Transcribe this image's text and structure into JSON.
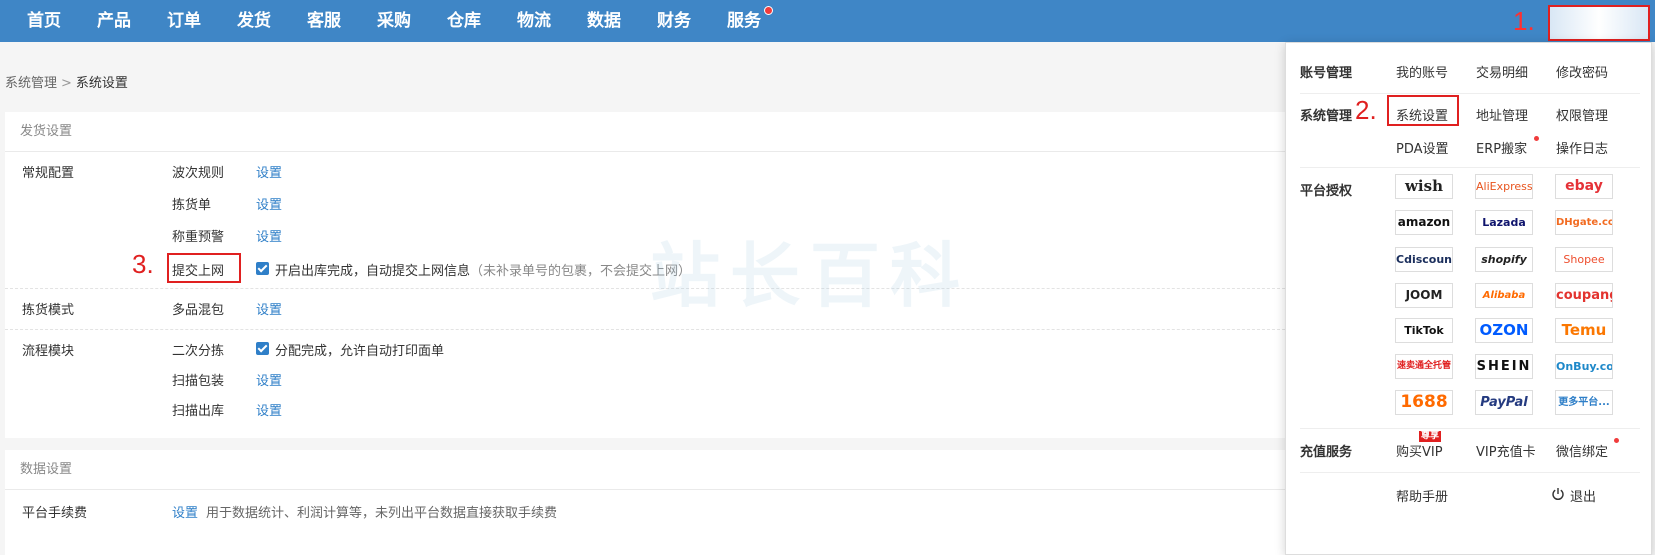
{
  "nav": {
    "items": [
      "首页",
      "产品",
      "订单",
      "发货",
      "客服",
      "采购",
      "仓库",
      "物流",
      "数据",
      "财务",
      "服务"
    ],
    "accent": "#3f86c6"
  },
  "markers": {
    "m1": "1.",
    "m2": "2.",
    "m3": "3."
  },
  "breadcrumb": {
    "parent": "系统管理",
    "sep": ">",
    "current": "系统设置"
  },
  "shipping": {
    "title": "发货设置",
    "groups": [
      {
        "label": "常规配置",
        "rows": [
          {
            "label": "波次规则",
            "link": "设置"
          },
          {
            "label": "拣货单",
            "link": "设置"
          },
          {
            "label": "称重预警",
            "link": "设置"
          },
          {
            "label": "提交上网",
            "checkbox": "开启出库完成，自动提交上网信息",
            "note": "（未补录单号的包裹，不会提交上网）"
          }
        ]
      },
      {
        "label": "拣货模式",
        "rows": [
          {
            "label": "多品混包",
            "link": "设置"
          }
        ]
      },
      {
        "label": "流程模块",
        "rows": [
          {
            "label": "二次分拣",
            "checkbox": "分配完成，允许自动打印面单"
          },
          {
            "label": "扫描包装",
            "link": "设置"
          },
          {
            "label": "扫描出库",
            "link": "设置"
          }
        ]
      }
    ]
  },
  "data_settings": {
    "title": "数据设置",
    "fee_label": "平台手续费",
    "fee_link": "设置",
    "fee_desc": "用于数据统计、利润计算等，未列出平台数据直接获取手续费"
  },
  "dropdown": {
    "account": {
      "title": "账号管理",
      "links": [
        "我的账号",
        "交易明细",
        "修改密码"
      ]
    },
    "system": {
      "title": "系统管理",
      "links": [
        "系统设置",
        "地址管理",
        "权限管理",
        "PDA设置",
        "ERP搬家",
        "操作日志"
      ]
    },
    "platforms": {
      "title": "平台授权",
      "items": [
        "wish",
        "AliExpress",
        "ebay",
        "amazon",
        "Lazada",
        "DHgate.com",
        "Cdiscount",
        "shopify",
        "Shopee",
        "JOOM",
        "Alibaba",
        "coupang",
        "TikTok",
        "OZON",
        "Temu",
        "速卖通全托管",
        "SHEIN",
        "OnBuy.com",
        "1688",
        "PayPal",
        "更多平台..."
      ]
    },
    "recharge": {
      "title": "充值服务",
      "links": [
        "购买VIP",
        "VIP充值卡",
        "微信绑定"
      ],
      "hot": "尊享"
    },
    "help": "帮助手册",
    "logout": "退出"
  },
  "watermark": "站长百科"
}
